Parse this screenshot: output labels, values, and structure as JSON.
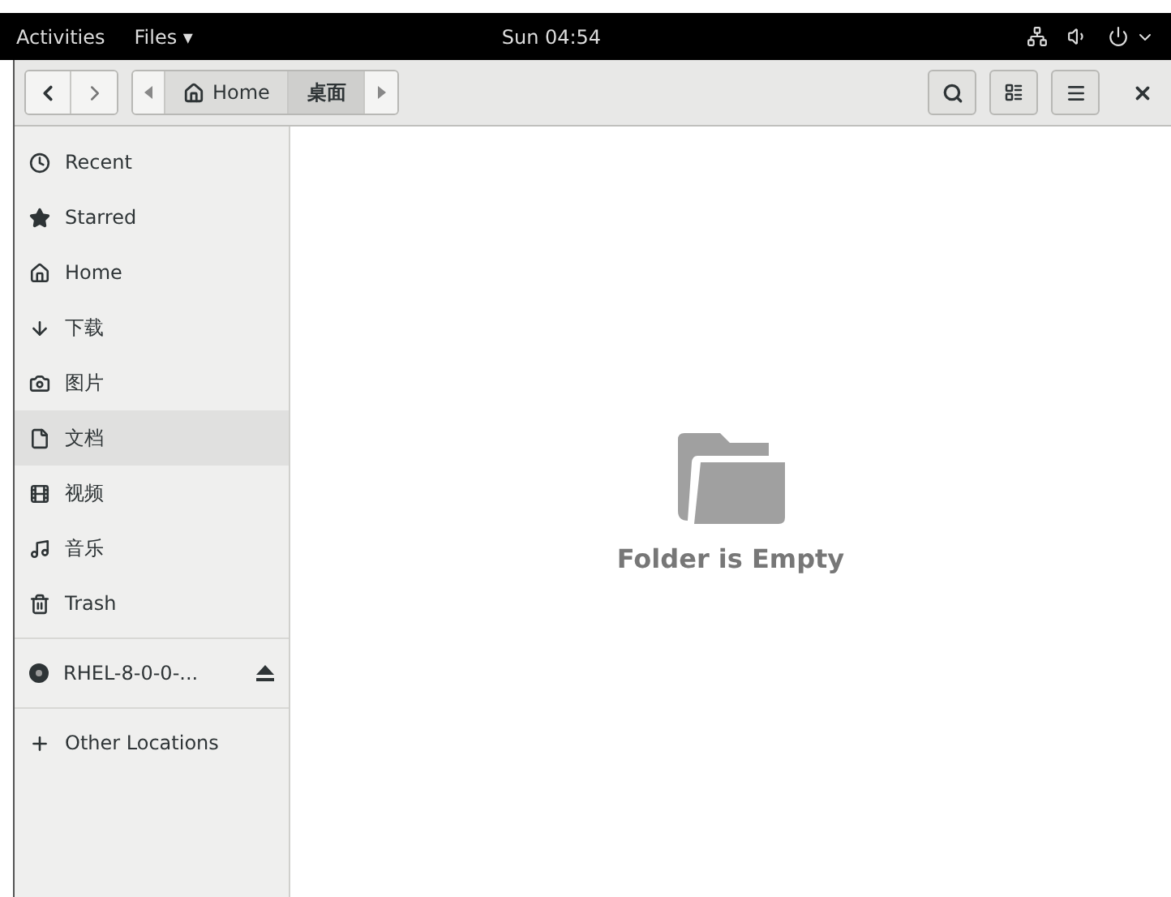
{
  "top_bar": {
    "activities": "Activities",
    "app_menu": "Files ▾",
    "clock": "Sun 04:54"
  },
  "path_bar": [
    {
      "label": "Home",
      "kind": "home",
      "selected": false
    },
    {
      "label": "桌面",
      "kind": "folder",
      "selected": true
    }
  ],
  "sidebar": {
    "places": [
      {
        "label": "Recent",
        "kind": "recent",
        "selected": false
      },
      {
        "label": "Starred",
        "kind": "starred",
        "selected": false
      },
      {
        "label": "Home",
        "kind": "home",
        "selected": false
      },
      {
        "label": "下载",
        "kind": "download",
        "selected": false
      },
      {
        "label": "图片",
        "kind": "pictures",
        "selected": false
      },
      {
        "label": "文档",
        "kind": "documents",
        "selected": true
      },
      {
        "label": "视频",
        "kind": "videos",
        "selected": false
      },
      {
        "label": "音乐",
        "kind": "music",
        "selected": false
      },
      {
        "label": "Trash",
        "kind": "trash",
        "selected": false
      }
    ],
    "devices": [
      {
        "label": "RHEL-8-0-0-...",
        "kind": "disc",
        "selected": false
      }
    ],
    "other": [
      {
        "label": "Other Locations",
        "kind": "other",
        "selected": false
      }
    ]
  },
  "content": {
    "message": "Folder is Empty"
  }
}
